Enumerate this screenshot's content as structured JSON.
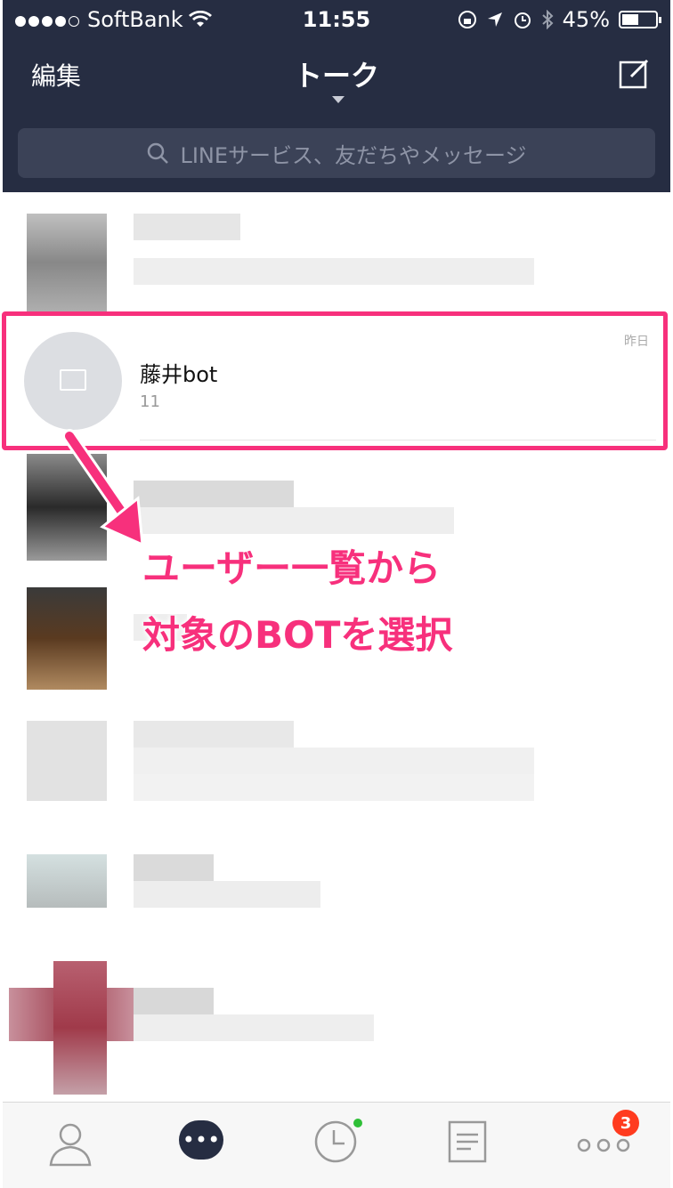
{
  "status_bar": {
    "carrier": "SoftBank",
    "time": "11:55",
    "battery": "45%",
    "battery_level": 0.45
  },
  "nav": {
    "edit_label": "編集",
    "title": "トーク"
  },
  "search": {
    "placeholder": "LINEサービス、友だちやメッセージ"
  },
  "chat_rows": [
    {
      "name": "藤井bot",
      "last_message": "11",
      "date": "昨日",
      "selected": true
    }
  ],
  "annotation": {
    "line1": "ユーザー一覧から",
    "line2": "対象のBOTを選択"
  },
  "tabbar": {
    "more_badge": "3"
  },
  "colors": {
    "header": "#262d42",
    "highlight": "#f7307c",
    "badge": "#ff3b1f",
    "online": "#2fbf37"
  }
}
